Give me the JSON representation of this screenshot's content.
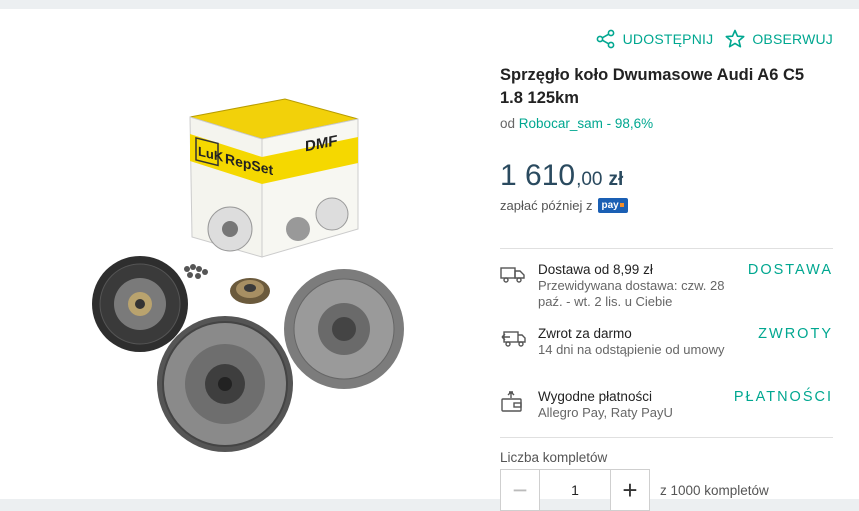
{
  "actions": {
    "share_label": "UDOSTĘPNIJ",
    "watch_label": "OBSERWUJ"
  },
  "product": {
    "title": "Sprzęgło koło Dwumasowe Audi A6 C5 1.8 125km",
    "seller_prefix": "od",
    "seller_name": "Robocar_sam - 98,6%",
    "price_int": "1 610",
    "price_dec": ",00",
    "currency": "zł",
    "pay_later_text": "zapłać później z",
    "pay_badge": "pay"
  },
  "box_branding": {
    "luk": "LuK",
    "repset": "RepSet",
    "dmf": "DMF"
  },
  "info": [
    {
      "icon": "truck-icon",
      "title": "Dostawa od 8,99 zł",
      "subtitle": "Przewidywana dostawa: czw. 28 paź. - wt. 2 lis. u Ciebie",
      "link": "DOSTAWA"
    },
    {
      "icon": "return-icon",
      "title": "Zwrot za darmo",
      "subtitle": "14 dni na odstąpienie od umowy",
      "link": "ZWROTY"
    },
    {
      "icon": "wallet-icon",
      "title": "Wygodne płatności",
      "subtitle": "Allegro Pay, Raty PayU",
      "link": "PŁATNOŚCI"
    }
  ],
  "quantity": {
    "label": "Liczba kompletów",
    "minus": "−",
    "value": "1",
    "plus": "+",
    "of_text": "z 1000 kompletów"
  },
  "colors": {
    "accent": "#00a790",
    "price": "#2a4a5f",
    "luk_yellow": "#f5d800"
  }
}
